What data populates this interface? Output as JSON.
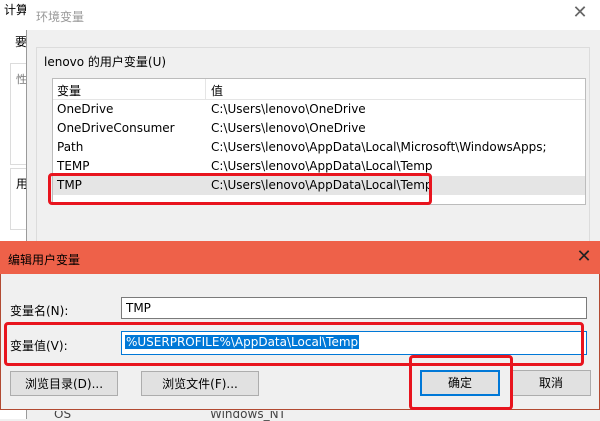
{
  "background_window": {
    "title": "计算",
    "fragment_1": "要",
    "fragment_2": "性",
    "fragment_3": "用"
  },
  "env_dialog": {
    "title": "环境变量",
    "close_icon": "close-icon",
    "user_vars_label": "lenovo 的用户变量(U)",
    "columns": {
      "name": "变量",
      "value": "值"
    },
    "rows": [
      {
        "name": "OneDrive",
        "value": "C:\\Users\\lenovo\\OneDrive"
      },
      {
        "name": "OneDriveConsumer",
        "value": "C:\\Users\\lenovo\\OneDrive"
      },
      {
        "name": "Path",
        "value": "C:\\Users\\lenovo\\AppData\\Local\\Microsoft\\WindowsApps;"
      },
      {
        "name": "TEMP",
        "value": "C:\\Users\\lenovo\\AppData\\Local\\Temp"
      },
      {
        "name": "TMP",
        "value": "C:\\Users\\lenovo\\AppData\\Local\\Temp"
      }
    ],
    "selected_row": "TMP",
    "system_row_partial": {
      "name": "OS",
      "value": "Windows_NT"
    }
  },
  "edit_dialog": {
    "title": "编辑用户变量",
    "close_icon": "close-icon",
    "title_color": "#ee6149",
    "name_label": "变量名(N):",
    "name_value": "TMP",
    "value_label": "变量值(V):",
    "value_value": "%USERPROFILE%\\AppData\\Local\\Temp",
    "browse_dir_label": "浏览目录(D)...",
    "browse_file_label": "浏览文件(F)...",
    "ok_label": "确定",
    "cancel_label": "取消"
  },
  "annotations": {
    "highlight_color": "#e8141e"
  }
}
